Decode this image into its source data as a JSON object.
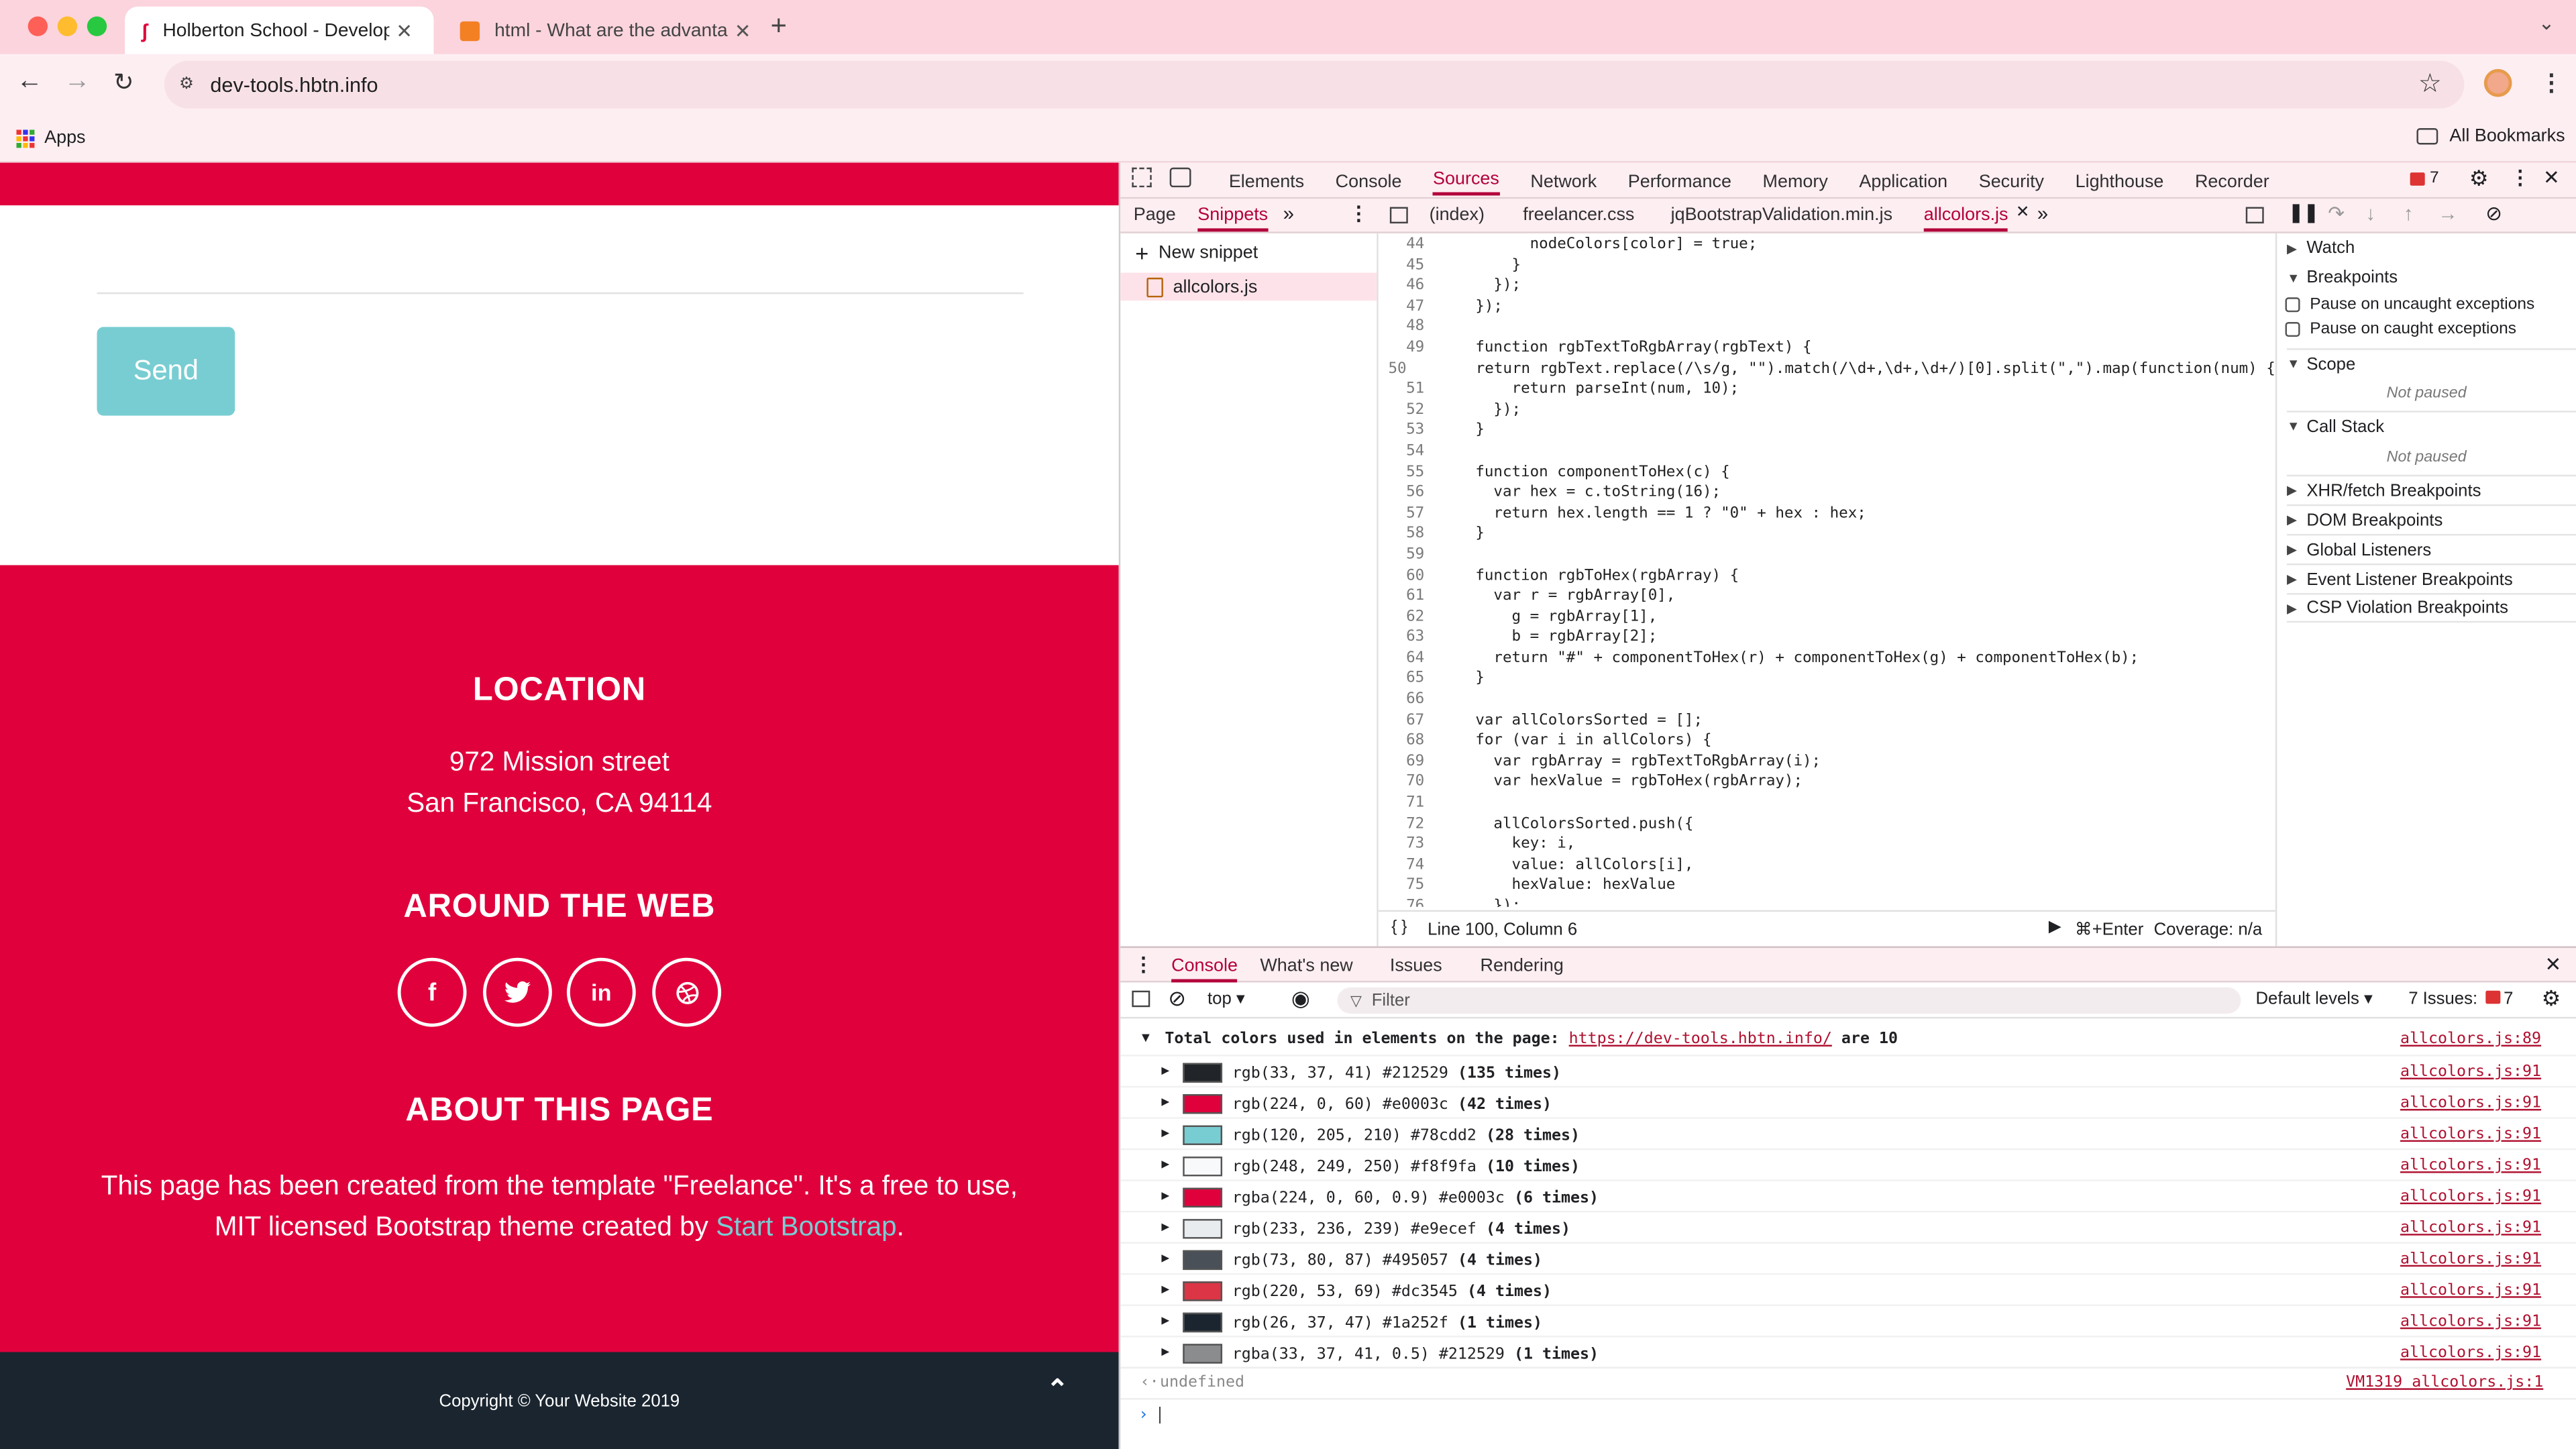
{
  "browser": {
    "tabs": [
      {
        "title": "Holberton School - Developer",
        "active": true
      },
      {
        "title": "html - What are the advantag",
        "active": false
      }
    ],
    "url": "dev-tools.hbtn.info",
    "bookmarks": {
      "apps": "Apps",
      "all": "All Bookmarks"
    }
  },
  "site": {
    "send_button": "Send",
    "location_title": "LOCATION",
    "address_line1": "972 Mission street",
    "address_line2": "San Francisco, CA 94114",
    "web_title": "AROUND THE WEB",
    "about_title": "ABOUT THIS PAGE",
    "about_text": "This page has been created from the template \"Freelance\". It's a free to use, MIT licensed Bootstrap theme created by",
    "about_link": "Start Bootstrap",
    "about_end": ".",
    "copyright": "Copyright © Your Website 2019",
    "colors": {
      "red": "#e0003c",
      "teal": "#78cdd2",
      "dark": "#1a252f"
    }
  },
  "devtools": {
    "main_tabs": [
      "Elements",
      "Console",
      "Sources",
      "Network",
      "Performance",
      "Memory",
      "Application",
      "Security",
      "Lighthouse",
      "Recorder"
    ],
    "issues_badge": "7",
    "nav_tabs": [
      "Page",
      "Snippets"
    ],
    "file_tabs": [
      "(index)",
      "freelancer.css",
      "jqBootstrapValidation.min.js",
      "allcolors.js"
    ],
    "new_snippet": "New snippet",
    "snippet_file": "allcolors.js",
    "code_lines": [
      {
        "n": "44",
        "t": "        nodeColors[color] = true;"
      },
      {
        "n": "45",
        "t": "      }"
      },
      {
        "n": "46",
        "t": "    });"
      },
      {
        "n": "47",
        "t": "  });"
      },
      {
        "n": "48",
        "t": ""
      },
      {
        "n": "49",
        "t": "  function rgbTextToRgbArray(rgbText) {"
      },
      {
        "n": "50",
        "t": "    return rgbText.replace(/\\s/g, \"\").match(/\\d+,\\d+,\\d+/)[0].split(\",\").map(function(num) {"
      },
      {
        "n": "51",
        "t": "      return parseInt(num, 10);"
      },
      {
        "n": "52",
        "t": "    });"
      },
      {
        "n": "53",
        "t": "  }"
      },
      {
        "n": "54",
        "t": ""
      },
      {
        "n": "55",
        "t": "  function componentToHex(c) {"
      },
      {
        "n": "56",
        "t": "    var hex = c.toString(16);"
      },
      {
        "n": "57",
        "t": "    return hex.length == 1 ? \"0\" + hex : hex;"
      },
      {
        "n": "58",
        "t": "  }"
      },
      {
        "n": "59",
        "t": ""
      },
      {
        "n": "60",
        "t": "  function rgbToHex(rgbArray) {"
      },
      {
        "n": "61",
        "t": "    var r = rgbArray[0],"
      },
      {
        "n": "62",
        "t": "      g = rgbArray[1],"
      },
      {
        "n": "63",
        "t": "      b = rgbArray[2];"
      },
      {
        "n": "64",
        "t": "    return \"#\" + componentToHex(r) + componentToHex(g) + componentToHex(b);"
      },
      {
        "n": "65",
        "t": "  }"
      },
      {
        "n": "66",
        "t": ""
      },
      {
        "n": "67",
        "t": "  var allColorsSorted = [];"
      },
      {
        "n": "68",
        "t": "  for (var i in allColors) {"
      },
      {
        "n": "69",
        "t": "    var rgbArray = rgbTextToRgbArray(i);"
      },
      {
        "n": "70",
        "t": "    var hexValue = rgbToHex(rgbArray);"
      },
      {
        "n": "71",
        "t": ""
      },
      {
        "n": "72",
        "t": "    allColorsSorted.push({"
      },
      {
        "n": "73",
        "t": "      key: i,"
      },
      {
        "n": "74",
        "t": "      value: allColors[i],"
      },
      {
        "n": "75",
        "t": "      hexValue: hexValue"
      },
      {
        "n": "76",
        "t": "    });"
      }
    ],
    "status_position": "Line 100, Column 6",
    "run_shortcut": "⌘+Enter",
    "coverage": "Coverage: n/a",
    "debugger": {
      "watch": "Watch",
      "breakpoints": "Breakpoints",
      "pause_uncaught": "Pause on uncaught exceptions",
      "pause_caught": "Pause on caught exceptions",
      "scope": "Scope",
      "not_paused": "Not paused",
      "call_stack": "Call Stack",
      "sections": [
        "XHR/fetch Breakpoints",
        "DOM Breakpoints",
        "Global Listeners",
        "Event Listener Breakpoints",
        "CSP Violation Breakpoints"
      ]
    },
    "drawer_tabs": [
      "Console",
      "What's new",
      "Issues",
      "Rendering"
    ],
    "console_toolbar": {
      "context": "top",
      "filter": "Filter",
      "levels": "Default levels",
      "issues": "7 Issues:",
      "issues_count": "7"
    },
    "console_header": {
      "prefix": "Total colors used in elements on the page:",
      "url": "https://dev-tools.hbtn.info/",
      "suffix": "are 10",
      "source": "allcolors.js:89"
    },
    "console_rows": [
      {
        "color": "#212529",
        "text": "rgb(33, 37, 41) #212529",
        "count": "(135 times)",
        "source": "allcolors.js:91"
      },
      {
        "color": "#e0003c",
        "text": "rgb(224, 0, 60) #e0003c",
        "count": "(42 times)",
        "source": "allcolors.js:91"
      },
      {
        "color": "#78cdd2",
        "text": "rgb(120, 205, 210) #78cdd2",
        "count": "(28 times)",
        "source": "allcolors.js:91"
      },
      {
        "color": "#f8f9fa",
        "text": "rgb(248, 249, 250) #f8f9fa",
        "count": "(10 times)",
        "source": "allcolors.js:91"
      },
      {
        "color": "#e0003c",
        "text": "rgba(224, 0, 60, 0.9) #e0003c",
        "count": "(6 times)",
        "source": "allcolors.js:91"
      },
      {
        "color": "#e9ecef",
        "text": "rgb(233, 236, 239) #e9ecef",
        "count": "(4 times)",
        "source": "allcolors.js:91"
      },
      {
        "color": "#495057",
        "text": "rgb(73, 80, 87) #495057",
        "count": "(4 times)",
        "source": "allcolors.js:91"
      },
      {
        "color": "#dc3545",
        "text": "rgb(220, 53, 69) #dc3545",
        "count": "(4 times)",
        "source": "allcolors.js:91"
      },
      {
        "color": "#1a252f",
        "text": "rgb(26, 37, 47) #1a252f",
        "count": "(1 times)",
        "source": "allcolors.js:91"
      },
      {
        "color": "#8a8c8e",
        "text": "rgba(33, 37, 41, 0.5) #212529",
        "count": "(1 times)",
        "source": "allcolors.js:91"
      }
    ],
    "undefined_text": "undefined",
    "undefined_source": "VM1319 allcolors.js:1",
    "prompt": "|"
  }
}
